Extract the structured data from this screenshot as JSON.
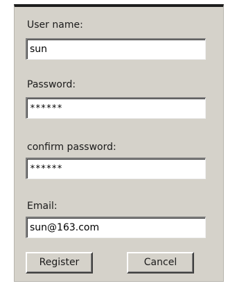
{
  "form": {
    "username_label": "User name:",
    "username_value": "sun",
    "password_label": "Password:",
    "password_value": "******",
    "confirm_label": "confirm password:",
    "confirm_value": "******",
    "email_label": "Email:",
    "email_value": "sun@163.com"
  },
  "buttons": {
    "register_label": "Register",
    "cancel_label": "Cancel"
  },
  "colors": {
    "panel_background": "#d5d2ca",
    "field_background": "#ffffff",
    "top_border": "#1e1e1e"
  }
}
